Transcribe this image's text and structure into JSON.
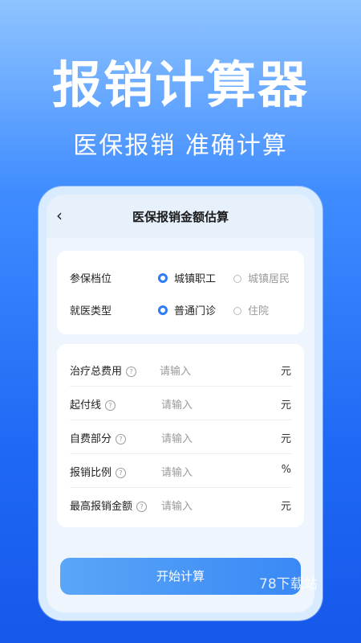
{
  "hero": {
    "title": "报销计算器",
    "subtitle": "医保报销 准确计算"
  },
  "nav": {
    "back": "‹",
    "title": "医保报销金额估算"
  },
  "options": [
    {
      "label": "参保档位",
      "choices": [
        "城镇职工",
        "城镇居民"
      ],
      "selected": 0
    },
    {
      "label": "就医类型",
      "choices": [
        "普通门诊",
        "住院"
      ],
      "selected": 0
    }
  ],
  "inputs": [
    {
      "label": "治疗总费用",
      "placeholder": "请输入",
      "unit": "元"
    },
    {
      "label": "起付线",
      "placeholder": "请输入",
      "unit": "元"
    },
    {
      "label": "自费部分",
      "placeholder": "请输入",
      "unit": "元"
    },
    {
      "label": "报销比例",
      "placeholder": "请输入",
      "unit": "%"
    },
    {
      "label": "最高报销金额",
      "placeholder": "请输入",
      "unit": "元"
    }
  ],
  "help_glyph": "?",
  "button": {
    "label": "开始计算"
  },
  "watermark": "78下载站",
  "colors": {
    "accent": "#2f7cf6",
    "button": "#4a98f6"
  }
}
